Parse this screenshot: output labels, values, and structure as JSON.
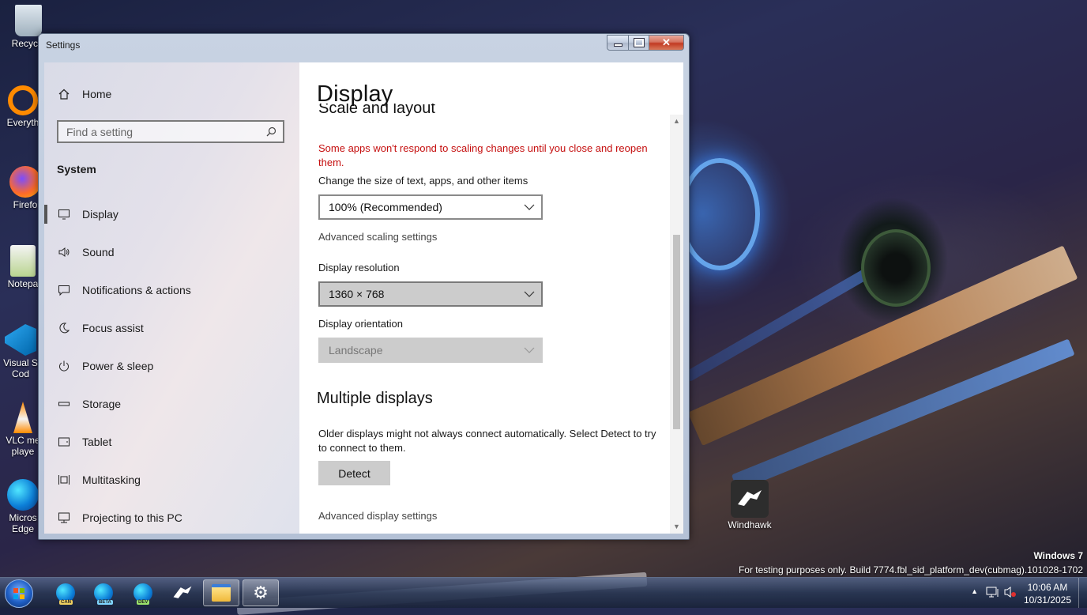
{
  "desktop": {
    "icons": [
      {
        "label": "Recycle",
        "icon": "recycle-bin-icon"
      },
      {
        "label": "Everyth",
        "icon": "everything-icon"
      },
      {
        "label": "Firefo",
        "icon": "firefox-icon"
      },
      {
        "label": "Notepa",
        "icon": "notepad-icon"
      },
      {
        "label": "Visual S\nCod",
        "icon": "vscode-icon"
      },
      {
        "label": "VLC me\nplaye",
        "icon": "vlc-icon"
      },
      {
        "label": "Micros\nEdge",
        "icon": "edge-icon"
      },
      {
        "label": "Windhawk",
        "icon": "windhawk-icon"
      }
    ],
    "watermark": {
      "line1": "Windows 7",
      "line2": "For testing purposes only. Build 7774.fbl_sid_platform_dev(cubmag).101028-1702"
    }
  },
  "window": {
    "title": "Settings",
    "controls": {
      "minimize": "minimize",
      "maximize": "maximize",
      "close": "close"
    }
  },
  "sidebar": {
    "home_label": "Home",
    "search_placeholder": "Find a setting",
    "section_label": "System",
    "items": [
      {
        "label": "Display",
        "icon": "monitor-icon",
        "active": true
      },
      {
        "label": "Sound",
        "icon": "speaker-icon"
      },
      {
        "label": "Notifications & actions",
        "icon": "notification-icon"
      },
      {
        "label": "Focus assist",
        "icon": "moon-icon"
      },
      {
        "label": "Power & sleep",
        "icon": "power-icon"
      },
      {
        "label": "Storage",
        "icon": "storage-icon"
      },
      {
        "label": "Tablet",
        "icon": "tablet-icon"
      },
      {
        "label": "Multitasking",
        "icon": "multitasking-icon"
      },
      {
        "label": "Projecting to this PC",
        "icon": "projecting-icon"
      }
    ]
  },
  "main": {
    "title": "Display",
    "section_scale": "Scale and layout",
    "scale_warning": "Some apps won't respond to scaling changes until you close and reopen them.",
    "scale_label": "Change the size of text, apps, and other items",
    "scale_value": "100% (Recommended)",
    "advanced_scaling": "Advanced scaling settings",
    "resolution_label": "Display resolution",
    "resolution_value": "1360 × 768",
    "orientation_label": "Display orientation",
    "orientation_value": "Landscape",
    "multiple_title": "Multiple displays",
    "multiple_text": "Older displays might not always connect automatically. Select Detect to try to connect to them.",
    "detect_label": "Detect",
    "advanced_display": "Advanced display settings"
  },
  "taskbar": {
    "pinned": [
      {
        "name": "edge-canary",
        "tag": "CAN"
      },
      {
        "name": "edge-beta",
        "tag": "BETA"
      },
      {
        "name": "edge-dev",
        "tag": "DEV"
      },
      {
        "name": "windhawk"
      },
      {
        "name": "file-explorer"
      },
      {
        "name": "settings"
      }
    ],
    "clock_time": "10:06 AM",
    "clock_date": "10/31/2025"
  },
  "colors": {
    "warning": "#c50f0f",
    "accent": "#1e5ec4"
  }
}
